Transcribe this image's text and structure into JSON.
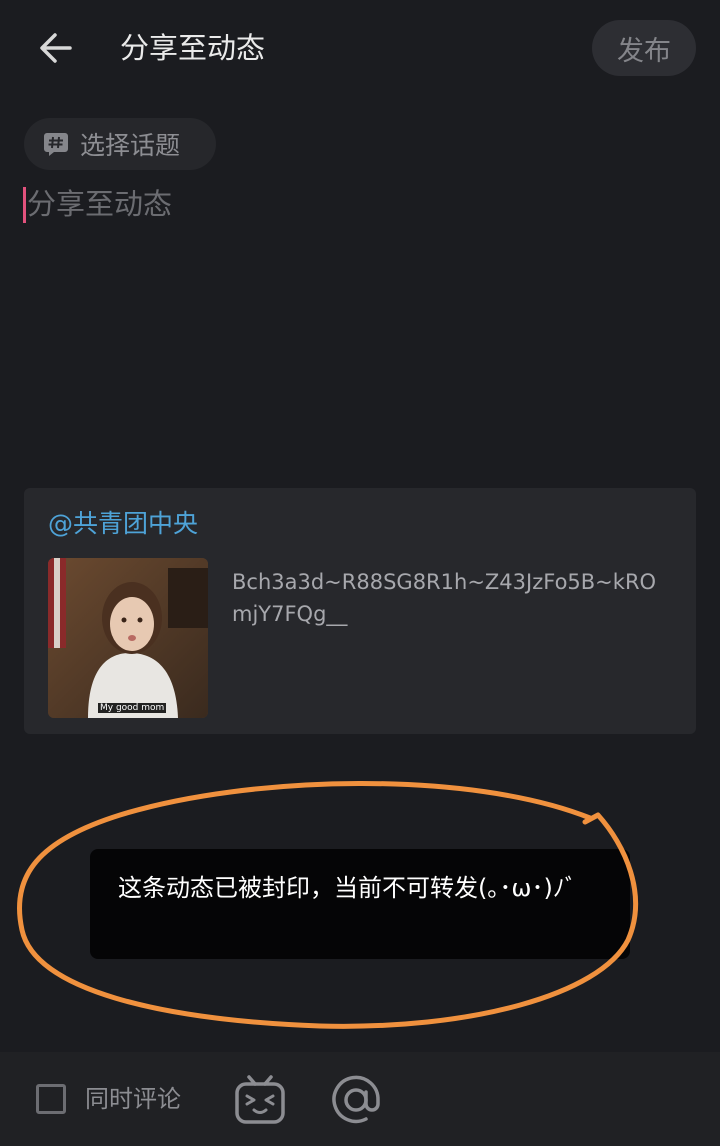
{
  "header": {
    "title": "分享至动态",
    "publish_label": "发布"
  },
  "topic": {
    "label": "选择话题",
    "icon": "hashtag-bubble-icon"
  },
  "editor": {
    "placeholder": "分享至动态",
    "caret_color": "#e2527d"
  },
  "shared_card": {
    "author": "@共青团中央",
    "text": "Bch3a3d~R88SG8R1h~Z43JzFo5B~kROmjY7FQg__",
    "thumbnail_caption": "My good mom"
  },
  "toast": {
    "message": "这条动态已被封印，当前不可转发(｡･ω･)ﾉﾞ"
  },
  "bottom_bar": {
    "comment_checkbox_label": "同时评论",
    "comment_checked": false,
    "emoji_icon": "tv-emoji-icon",
    "mention_icon": "at-icon"
  },
  "colors": {
    "background": "#1b1c20",
    "link": "#4ea3d8",
    "annotation": "#f0913e"
  }
}
